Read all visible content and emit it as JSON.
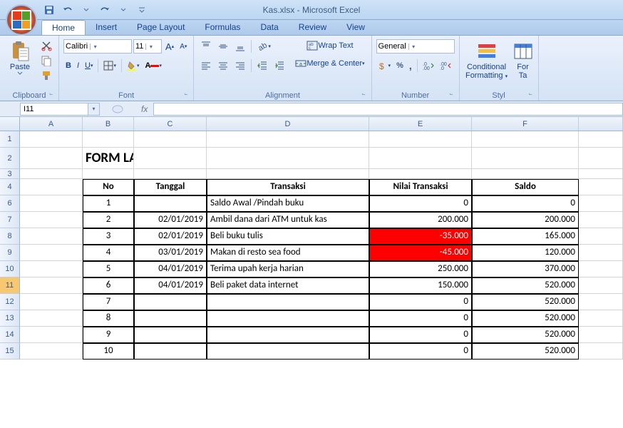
{
  "title": "Kas.xlsx - Microsoft Excel",
  "tabs": [
    "Home",
    "Insert",
    "Page Layout",
    "Formulas",
    "Data",
    "Review",
    "View"
  ],
  "active_tab": "Home",
  "font": {
    "name": "Calibri",
    "size": "11"
  },
  "number_format": "General",
  "groups": {
    "clipboard": "Clipboard",
    "font": "Font",
    "alignment": "Alignment",
    "number": "Number",
    "styles": "Styl"
  },
  "ribbon": {
    "paste": "Paste",
    "wrap": "Wrap Text",
    "merge": "Merge & Center",
    "cond": "Conditional",
    "cond2": "Formatting",
    "format": "For",
    "format2": "Ta"
  },
  "namebox": "I11",
  "fx": "fx",
  "columns": [
    "A",
    "B",
    "C",
    "D",
    "E",
    "F"
  ],
  "sheet_title": "FORM LAPORAN KAS",
  "headers": {
    "no": "No",
    "tanggal": "Tanggal",
    "transaksi": "Transaksi",
    "nilai": "Nilai Transaksi",
    "saldo": "Saldo"
  },
  "rows": [
    {
      "no": "1",
      "tanggal": "",
      "transaksi": "Saldo Awal /Pindah buku",
      "nilai": "0",
      "saldo": "0",
      "neg": false
    },
    {
      "no": "2",
      "tanggal": "02/01/2019",
      "transaksi": "Ambil dana dari ATM untuk kas",
      "nilai": "200.000",
      "saldo": "200.000",
      "neg": false
    },
    {
      "no": "3",
      "tanggal": "02/01/2019",
      "transaksi": "Beli buku tulis",
      "nilai": "-35.000",
      "saldo": "165.000",
      "neg": true
    },
    {
      "no": "4",
      "tanggal": "03/01/2019",
      "transaksi": "Makan di resto sea food",
      "nilai": "-45.000",
      "saldo": "120.000",
      "neg": true
    },
    {
      "no": "5",
      "tanggal": "04/01/2019",
      "transaksi": "Terima upah kerja harian",
      "nilai": "250.000",
      "saldo": "370.000",
      "neg": false
    },
    {
      "no": "6",
      "tanggal": "04/01/2019",
      "transaksi": "Beli paket data internet",
      "nilai": "150.000",
      "saldo": "520.000",
      "neg": false
    },
    {
      "no": "7",
      "tanggal": "",
      "transaksi": "",
      "nilai": "0",
      "saldo": "520.000",
      "neg": false
    },
    {
      "no": "8",
      "tanggal": "",
      "transaksi": "",
      "nilai": "0",
      "saldo": "520.000",
      "neg": false
    },
    {
      "no": "9",
      "tanggal": "",
      "transaksi": "",
      "nilai": "0",
      "saldo": "520.000",
      "neg": false
    },
    {
      "no": "10",
      "tanggal": "",
      "transaksi": "",
      "nilai": "0",
      "saldo": "520.000",
      "neg": false
    }
  ],
  "row_numbers": [
    "1",
    "2",
    "3",
    "4",
    "6",
    "7",
    "8",
    "9",
    "10",
    "11",
    "12",
    "13",
    "14",
    "15"
  ]
}
